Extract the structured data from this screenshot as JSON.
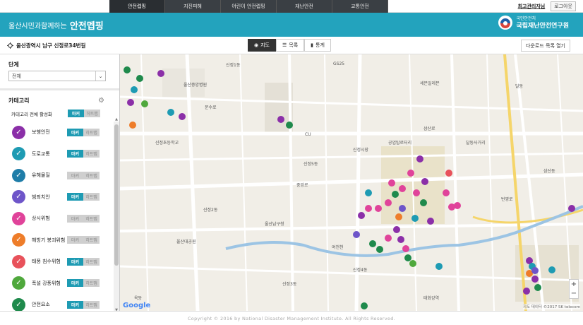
{
  "nav": {
    "tabs": [
      {
        "label": "안전렙핑"
      },
      {
        "label": "지진피해"
      },
      {
        "label": "어린이 안전렙핑"
      },
      {
        "label": "재난안전"
      },
      {
        "label": "교통안전"
      }
    ],
    "admin_link": "최고관리자님",
    "logout": "로그아웃"
  },
  "banner": {
    "subtitle": "울산시민과함께하는",
    "title": "안전멥핑",
    "org_small": "국민안전처",
    "org_name": "국립재난안전연구원"
  },
  "toolbar": {
    "location": "울산광역시 남구 신정로34번길",
    "views": [
      {
        "label": "지도",
        "icon": "pin-icon"
      },
      {
        "label": "목록",
        "icon": "list-icon"
      },
      {
        "label": "통계",
        "icon": "chart-icon"
      }
    ],
    "download": "다운로드 목록 열기"
  },
  "sidebar": {
    "level_title": "단계",
    "level_value": "전체",
    "category_title": "카테고리",
    "all_label": "카테고리 전체 활성화",
    "toggle_on": "마커",
    "toggle_off": "히트맵",
    "categories": [
      {
        "label": "보행안전",
        "color": "#8b2fa8",
        "active": true
      },
      {
        "label": "도로교통",
        "color": "#1e9bb3",
        "active": true
      },
      {
        "label": "유해물질",
        "color": "#1f7da8",
        "active": false
      },
      {
        "label": "범죄치안",
        "color": "#6e55c9",
        "active": true
      },
      {
        "label": "상시위험",
        "color": "#e0439a",
        "active": false
      },
      {
        "label": "해빙기 붕괴위험",
        "color": "#ee7d2a",
        "active": false
      },
      {
        "label": "태풍 침수위험",
        "color": "#e8525b",
        "active": true
      },
      {
        "label": "폭설 강풍위험",
        "color": "#4fa83c",
        "active": true
      },
      {
        "label": "안전요소",
        "color": "#1f8a4c",
        "active": true
      }
    ]
  },
  "map": {
    "labels": [
      "신정1동",
      "신정2동",
      "신정3동",
      "신정4동",
      "신정5동",
      "옥동",
      "달동",
      "삼산동",
      "울산대공원",
      "태화강역",
      "달동사거리",
      "공업탑로터리",
      "울산남구청",
      "신정시장",
      "삼산로",
      "번영로",
      "문수로",
      "중앙로",
      "GS25",
      "CU",
      "세븐일레븐",
      "여천천",
      "울산중앙병원",
      "신정초등학교"
    ],
    "attribution": "지도 데이터 ©2017 SK telecom",
    "google": "Google"
  },
  "footer": "Copyright © 2016 by National Disaster Management Institute. All Rights Reserved."
}
